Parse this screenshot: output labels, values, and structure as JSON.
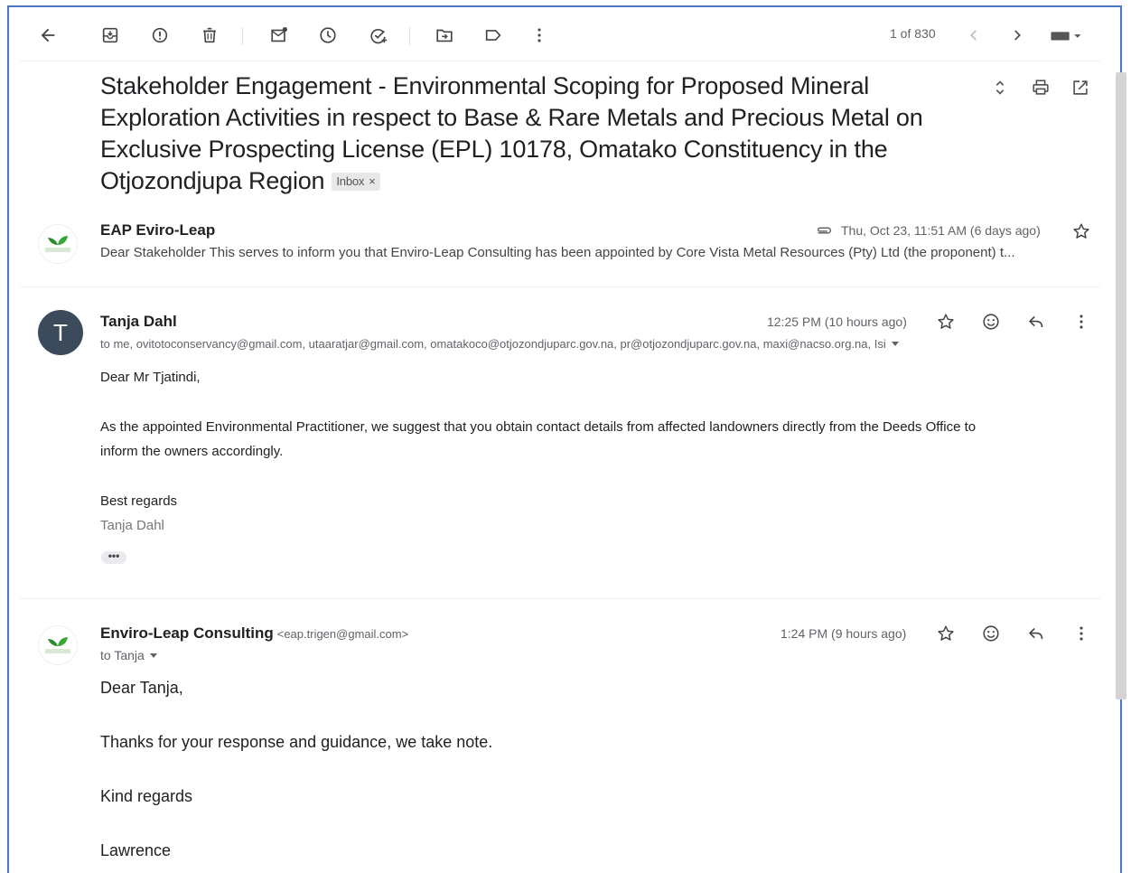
{
  "toolbar": {
    "pager_text": "1 of 830"
  },
  "subject": {
    "title": "Stakeholder Engagement - Environmental Scoping for Proposed Mineral Exploration Activities in respect to Base & Rare Metals and Precious Metal on Exclusive Prospecting License (EPL) 10178, Omatako Constituency in the Otjozondjupa Region",
    "label_chip": "Inbox",
    "label_remove": "×"
  },
  "messages": [
    {
      "sender": "EAP Eviro-Leap",
      "date": "Thu, Oct 23, 11:51 AM (6 days ago)",
      "snippet": "Dear Stakeholder This serves to inform you that Enviro-Leap Consulting has been appointed by Core Vista Metal Resources (Pty) Ltd (the proponent) t..."
    },
    {
      "avatar_letter": "T",
      "sender": "Tanja Dahl",
      "date": "12:25 PM (10 hours ago)",
      "to": "to me, ovitotoconservancy@gmail.com, utaaratjar@gmail.com, omatakoco@otjozondjuparc.gov.na, pr@otjozondjuparc.gov.na, maxi@nacso.org.na, Isi",
      "greeting": "Dear Mr Tjatindi,",
      "paragraph_1": "As the appointed Environmental Practitioner, we suggest that you obtain contact details from affected landowners directly from the Deeds Office to",
      "paragraph_2": "inform the owners accordingly.",
      "closing": "Best regards",
      "signature": "Tanja Dahl",
      "trimmed": "•••"
    },
    {
      "sender": "Enviro-Leap Consulting",
      "sender_email": "<eap.trigen@gmail.com>",
      "date": "1:24 PM (9 hours ago)",
      "to": "to Tanja",
      "greeting": "Dear Tanja,",
      "paragraph_1": "Thanks for your response and guidance, we take note.",
      "closing": "Kind regards",
      "signature": "Lawrence"
    }
  ],
  "colors": {
    "frame_border": "#4a78c2",
    "avatar_bg": "#3b4b5c",
    "text_primary": "#202124",
    "text_secondary": "#5f6368"
  },
  "icons": [
    "back-arrow-icon",
    "archive-icon",
    "report-spam-icon",
    "delete-icon",
    "mark-unread-icon",
    "snooze-icon",
    "add-task-icon",
    "move-to-icon",
    "label-icon",
    "more-vert-icon",
    "prev-icon",
    "next-icon",
    "keyboard-icon",
    "expand-all-icon",
    "print-icon",
    "open-new-window-icon",
    "attachment-icon",
    "star-icon",
    "emoji-icon",
    "reply-icon"
  ]
}
